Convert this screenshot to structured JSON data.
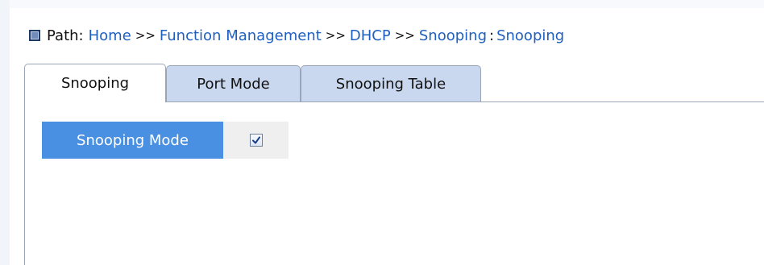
{
  "path": {
    "label": "Path:",
    "crumbs": [
      "Home",
      "Function Management",
      "DHCP",
      "Snooping"
    ],
    "separator": ">>",
    "current": "Snooping"
  },
  "tabs": [
    {
      "label": "Snooping",
      "active": true
    },
    {
      "label": "Port Mode",
      "active": false
    },
    {
      "label": "Snooping Table",
      "active": false
    }
  ],
  "form": {
    "snooping_mode_label": "Snooping Mode",
    "snooping_mode_checked": true
  },
  "colors": {
    "link": "#1f5fbf",
    "label_bg": "#4a90e2",
    "tab_inactive_bg": "#cad8ef"
  }
}
